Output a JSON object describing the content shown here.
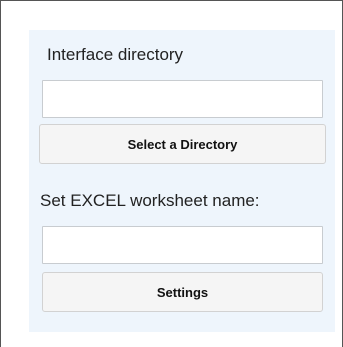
{
  "directory": {
    "label": "Interface directory",
    "value": "",
    "button_label": "Select a Directory"
  },
  "worksheet": {
    "label": "Set EXCEL worksheet name:",
    "value": "",
    "button_label": "Settings"
  },
  "colors": {
    "panel_background": "#eef5fc",
    "button_background": "#f5f5f5",
    "border": "#c8ccd0"
  }
}
